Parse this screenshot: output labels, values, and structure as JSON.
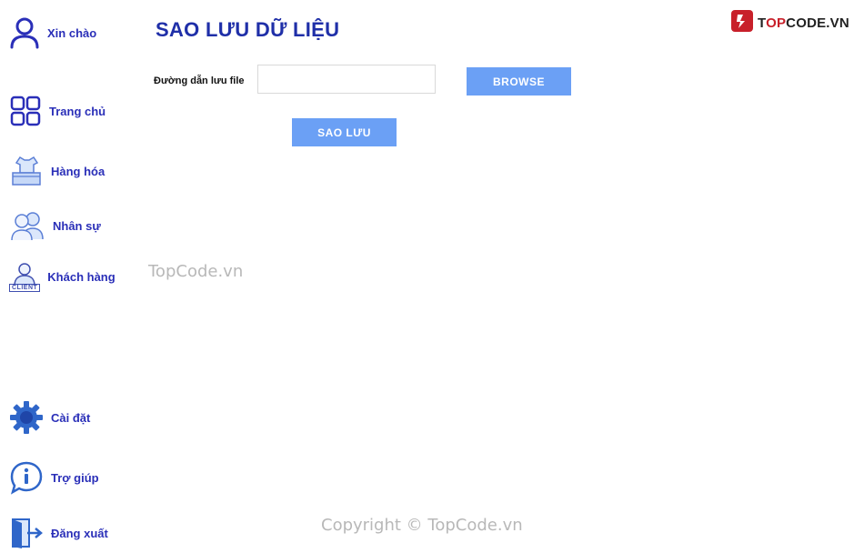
{
  "sidebar": {
    "greeting": "Xin chào",
    "items": [
      {
        "label": "Trang chủ",
        "icon": "grid-icon"
      },
      {
        "label": "Hàng hóa",
        "icon": "goods-box-icon"
      },
      {
        "label": "Nhân sự",
        "icon": "staff-people-icon"
      },
      {
        "label": "Khách hàng",
        "icon": "client-icon"
      }
    ],
    "bottom_items": [
      {
        "label": "Cài đặt",
        "icon": "gear-icon"
      },
      {
        "label": "Trợ giúp",
        "icon": "info-icon"
      },
      {
        "label": "Đăng xuất",
        "icon": "logout-door-icon"
      }
    ],
    "client_badge": "CLIENT"
  },
  "main": {
    "title": "SAO LƯU DỮ LIỆU",
    "path_label": "Đường dẫn lưu file",
    "path_value": "",
    "browse_label": "BROWSE",
    "save_label": "SAO LƯU"
  },
  "brand": {
    "logo_prefix": "T",
    "logo_accent": "OP",
    "logo_rest": "CODE.VN"
  },
  "watermark": "TopCode.vn",
  "copyright": "Copyright © TopCode.vn",
  "colors": {
    "accent": "#2a2fb8",
    "button": "#6ba0f5",
    "title": "#1f2fa8"
  }
}
